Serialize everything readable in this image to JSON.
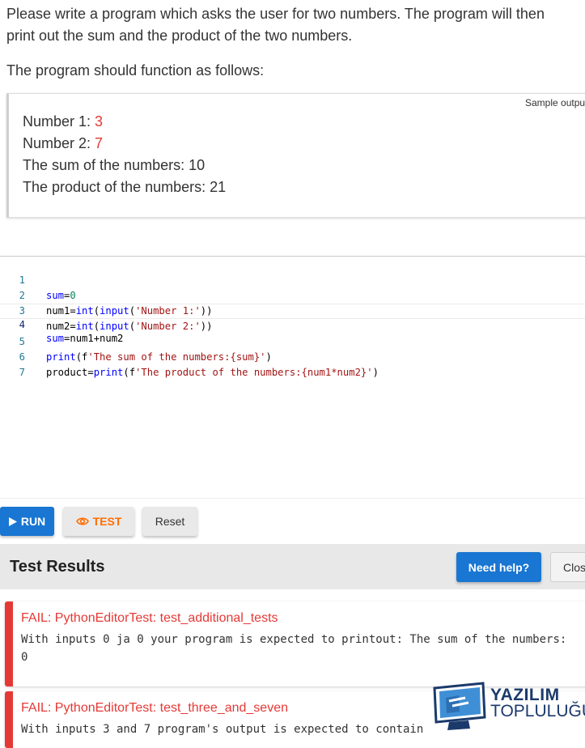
{
  "prompt": {
    "line1": "Please write a program which asks the user for two numbers. The program will then",
    "line2": "print out the sum and the product of the two numbers.",
    "line3": "The program should function as follows:"
  },
  "sample": {
    "label": "Sample outpu",
    "lines": [
      {
        "text": "Number 1: ",
        "input": "3"
      },
      {
        "text": "Number 2: ",
        "input": "7"
      },
      {
        "text": "The sum of the numbers: 10"
      },
      {
        "text": "The product of the numbers: 21"
      }
    ]
  },
  "editor": {
    "line_numbers": [
      "1",
      "2",
      "3",
      "4",
      "5",
      "6",
      "7"
    ],
    "code": [
      "sum=0",
      "num1=int(input('Number 1:'))",
      "num2=int(input('Number 2:'))",
      "sum=num1+num2",
      "print(f'The sum of the numbers:{sum}')",
      "product=print(f'The product of the numbers:{num1*num2}')",
      ""
    ]
  },
  "toolbar": {
    "run_label": "RUN",
    "test_label": "TEST",
    "reset_label": "Reset"
  },
  "results": {
    "title": "Test Results",
    "help_label": "Need help?",
    "close_label": "Clos",
    "items": [
      {
        "title": "FAIL: PythonEditorTest: test_additional_tests",
        "message": "With inputs 0 ja 0 your program is expected to printout: The sum of the numbers: 0"
      },
      {
        "title": "FAIL: PythonEditorTest: test_three_and_seven",
        "message": "With inputs 3 and 7 program's output is expected to contain"
      }
    ]
  },
  "watermark": {
    "line1": "YAZILIM",
    "line2": "TOPLULUĞU"
  },
  "colors": {
    "accent": "#1976d2",
    "fail": "#e53935",
    "test": "#ff6d00"
  }
}
